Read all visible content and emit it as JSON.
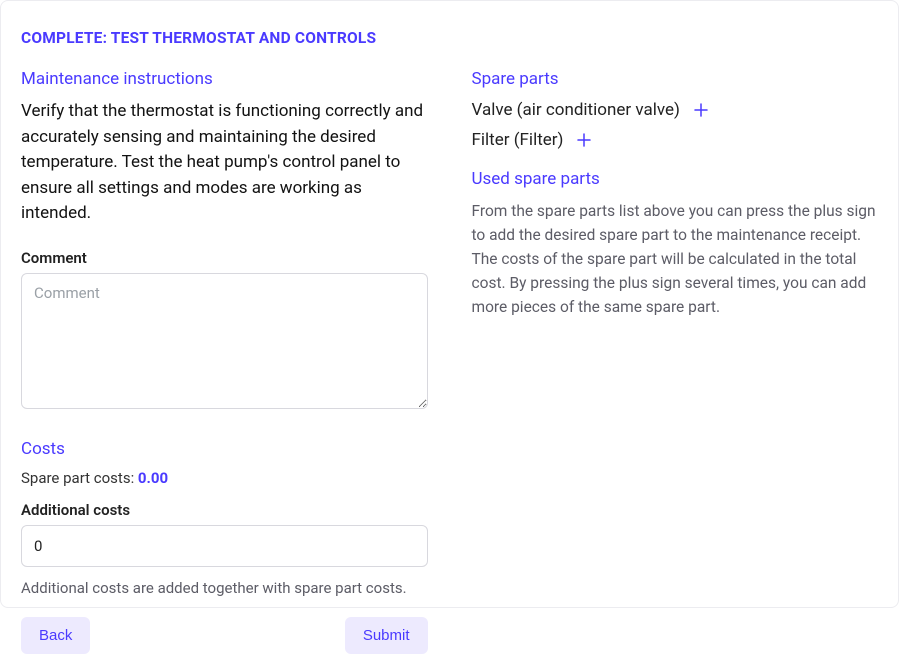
{
  "page_title": "COMPLETE: TEST THERMOSTAT AND CONTROLS",
  "left": {
    "instructions_heading": "Maintenance instructions",
    "instructions_body": "Verify that the thermostat is functioning correctly and accurately sensing and maintaining the desired temperature. Test the heat pump's control panel to ensure all settings and modes are working as intended.",
    "comment_label": "Comment",
    "comment_placeholder": "Comment",
    "comment_value": "",
    "costs_heading": "Costs",
    "spare_costs_label": "Spare part costs: ",
    "spare_costs_value": "0.00",
    "additional_label": "Additional costs",
    "additional_value": "0",
    "help_text": "Additional costs are added together with spare part costs.",
    "back_label": "Back",
    "submit_label": "Submit"
  },
  "right": {
    "spare_heading": "Spare parts",
    "spare_items": [
      {
        "label": "Valve (air conditioner valve)"
      },
      {
        "label": "Filter (Filter)"
      }
    ],
    "used_heading": "Used spare parts",
    "used_desc": "From the spare parts list above you can press the plus sign to add the desired spare part to the maintenance receipt. The costs of the spare part will be calculated in the total cost. By pressing the plus sign several times, you can add more pieces of the same spare part."
  }
}
